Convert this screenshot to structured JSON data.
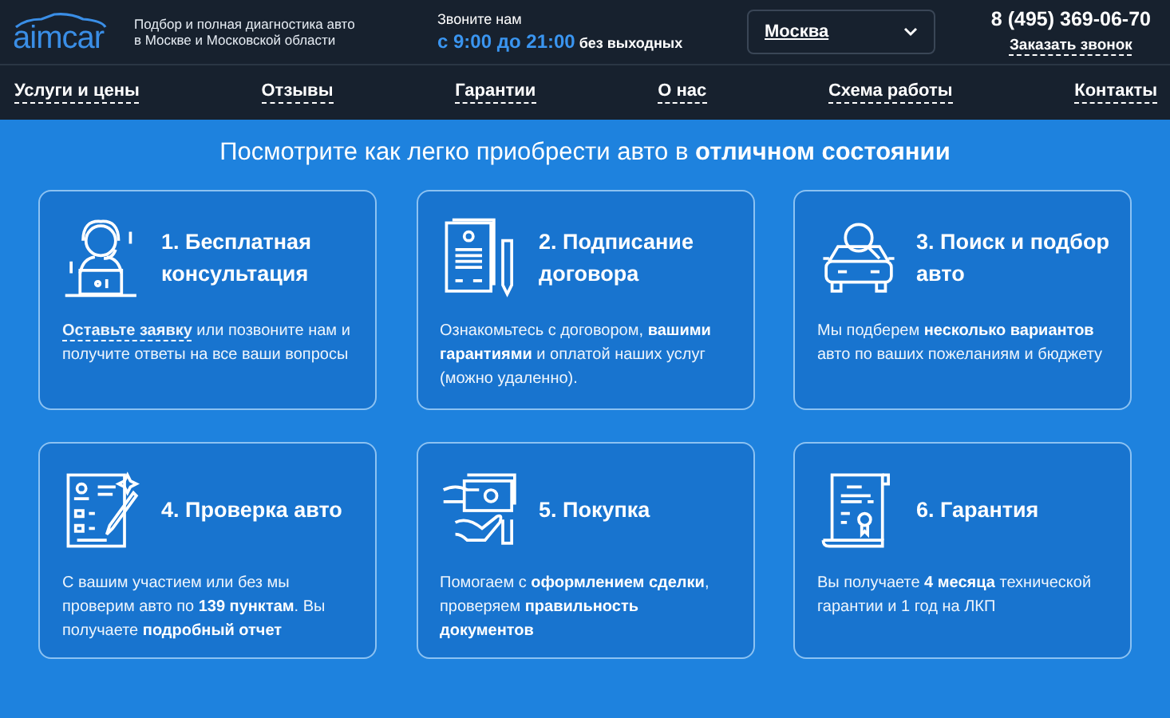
{
  "header": {
    "logo": "aimcar",
    "tagline": [
      "Подбор и полная диагностика авто",
      "в Москве и Московской области"
    ],
    "call_label": "Звоните нам",
    "hours": "с 9:00 до 21:00",
    "hours_note": "без выходных",
    "city": "Москва",
    "phone": "8 (495) 369-06-70",
    "callback": "Заказать звонок"
  },
  "nav": [
    "Услуги и цены",
    "Отзывы",
    "Гарантии",
    "О нас",
    "Схема работы",
    "Контакты"
  ],
  "heading": "Посмотрите как легко приобрести авто в **отличном состоянии**",
  "cards": [
    {
      "kind": "operator",
      "title": "1. Бесплатная консультация",
      "link": "Оставьте заявку",
      "text": " или позвоните нам и получите ответы на все ваши вопросы"
    },
    {
      "kind": "contract",
      "title": "2. Подписание договора",
      "text": "Ознакомьтесь с договором, **вашими гарантиями** и оплатой наших услуг (можно удаленно)."
    },
    {
      "kind": "search-car",
      "title": "3. Поиск и подбор авто",
      "text": "Мы подберем **несколько вариантов** авто по ваших пожеланиям и бюджету"
    },
    {
      "kind": "checklist",
      "title": "4. Проверка авто",
      "text": "С вашим участием или без мы проверим авто по **139 пунктам**. Вы получаете **подробный отчет**"
    },
    {
      "kind": "money",
      "title": "5. Покупка",
      "text": "Помогаем с **оформлением сделки**, проверяем **правильность документов**"
    },
    {
      "kind": "certificate",
      "title": "6. Гарантия",
      "text": "Вы получаете **4 месяца** технической гарантии и 1 год на ЛКП"
    }
  ]
}
